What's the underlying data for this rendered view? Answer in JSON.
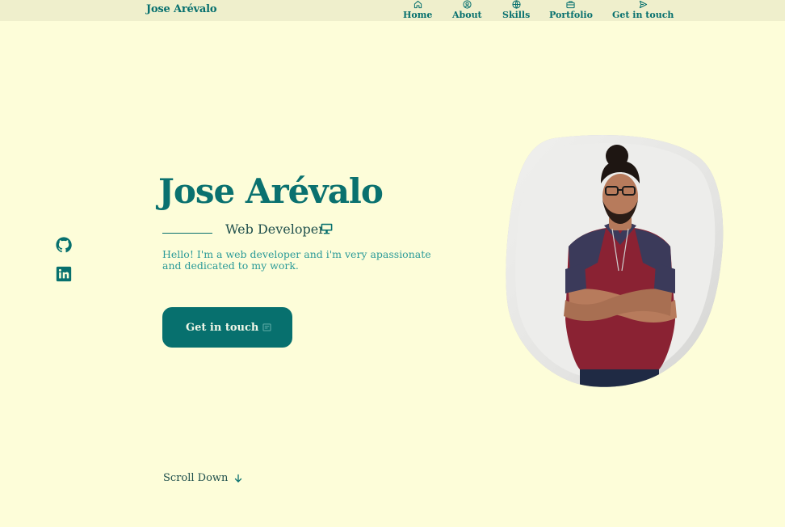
{
  "header": {
    "brand": "Jose Arévalo",
    "nav": [
      {
        "label": "Home",
        "icon": "home-icon"
      },
      {
        "label": "About",
        "icon": "user-circle-icon"
      },
      {
        "label": "Skills",
        "icon": "globe-icon"
      },
      {
        "label": "Portfolio",
        "icon": "briefcase-icon"
      },
      {
        "label": "Get in touch",
        "icon": "send-icon"
      }
    ]
  },
  "social": [
    {
      "icon": "github-icon"
    },
    {
      "icon": "linkedin-icon"
    }
  ],
  "hero": {
    "title": "Jose Arévalo",
    "subtitle": "Web Developer",
    "subtitle_icon": "monitor-icon",
    "description": "Hello! I'm a web developer and i'm very apassionate and dedicated to my work.",
    "cta_label": "Get in touch",
    "cta_icon": "message-icon",
    "photo_icon": "profile-photo"
  },
  "scroll": {
    "label": "Scroll Down",
    "icon": "arrow-down-icon"
  },
  "colors": {
    "background": "#fdfdd9",
    "header": "#efefcc",
    "accent": "#07706e",
    "text_light": "#2a9a98"
  }
}
